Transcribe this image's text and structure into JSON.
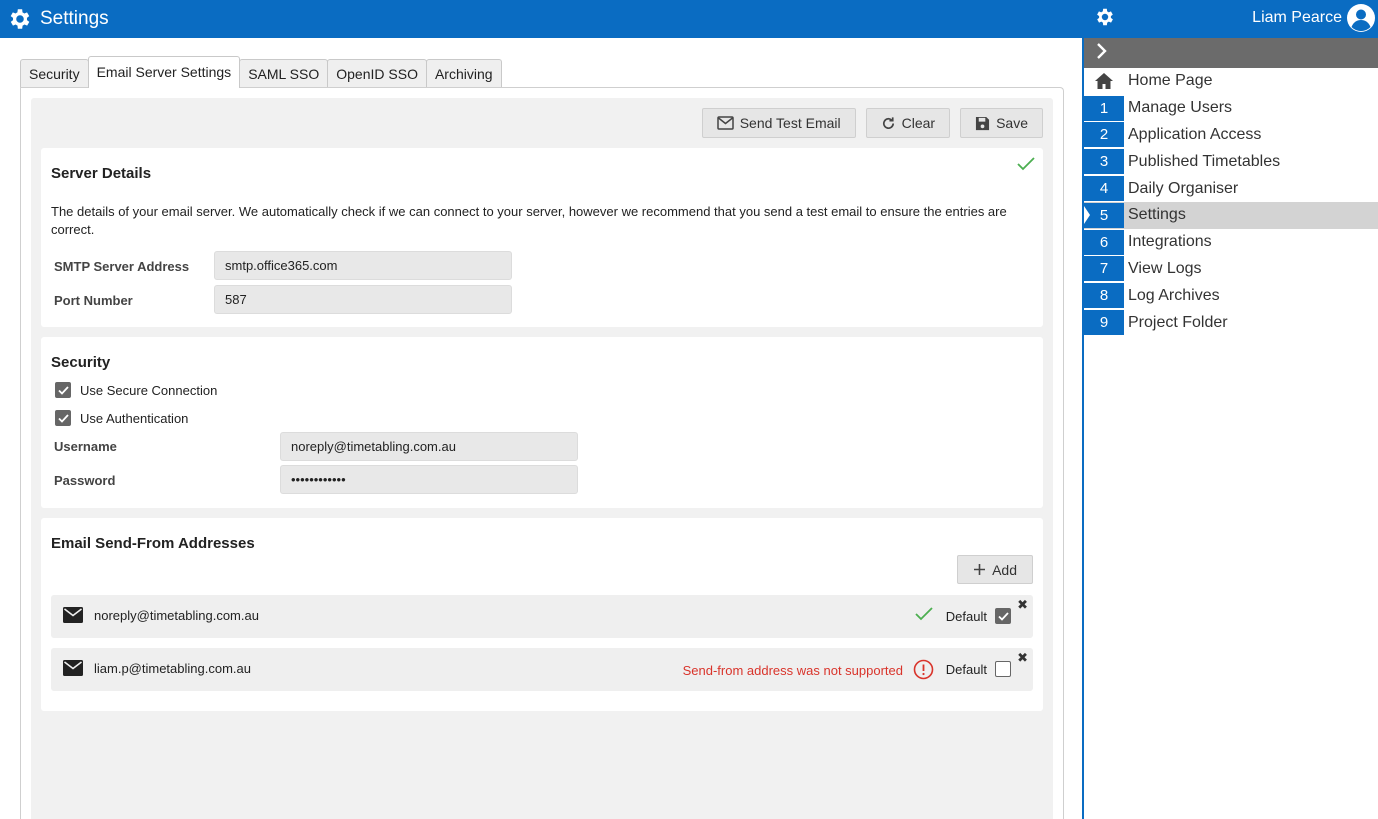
{
  "header": {
    "title": "Settings"
  },
  "tabs": [
    {
      "label": "Security",
      "active": false
    },
    {
      "label": "Email Server Settings",
      "active": true
    },
    {
      "label": "SAML SSO",
      "active": false
    },
    {
      "label": "OpenID SSO",
      "active": false
    },
    {
      "label": "Archiving",
      "active": false
    }
  ],
  "toolbar": {
    "send_test": "Send Test Email",
    "clear": "Clear",
    "save": "Save"
  },
  "server": {
    "title": "Server Details",
    "description": "The details of your email server. We automatically check if we can connect to your server, however we recommend that you send a test email to ensure the entries are correct.",
    "smtp_label": "SMTP Server Address",
    "smtp_value": "smtp.office365.com",
    "port_label": "Port Number",
    "port_value": "587"
  },
  "security": {
    "title": "Security",
    "secure_label": "Use Secure Connection",
    "secure_checked": true,
    "auth_label": "Use Authentication",
    "auth_checked": true,
    "username_label": "Username",
    "username_value": "noreply@timetabling.com.au",
    "password_label": "Password",
    "password_value": "••••••••••••"
  },
  "sendfrom": {
    "title": "Email Send-From Addresses",
    "add_label": "Add",
    "default_label": "Default",
    "addresses": [
      {
        "address": "noreply@timetabling.com.au",
        "status": "ok",
        "error": "",
        "default": true
      },
      {
        "address": "liam.p@timetabling.com.au",
        "status": "error",
        "error": "Send-from address was not supported",
        "default": false
      }
    ]
  },
  "sidebar": {
    "user": "Liam Pearce",
    "items": [
      {
        "num": "",
        "label": "Home Page",
        "icon": "home-icon"
      },
      {
        "num": "1",
        "label": "Manage Users"
      },
      {
        "num": "2",
        "label": "Application Access"
      },
      {
        "num": "3",
        "label": "Published Timetables"
      },
      {
        "num": "4",
        "label": "Daily Organiser"
      },
      {
        "num": "5",
        "label": "Settings",
        "active": true
      },
      {
        "num": "6",
        "label": "Integrations"
      },
      {
        "num": "7",
        "label": "View Logs"
      },
      {
        "num": "8",
        "label": "Log Archives"
      },
      {
        "num": "9",
        "label": "Project Folder"
      }
    ]
  },
  "colors": {
    "brand": "#0a6cc2",
    "success": "#4caf50",
    "error": "#d9342b"
  }
}
